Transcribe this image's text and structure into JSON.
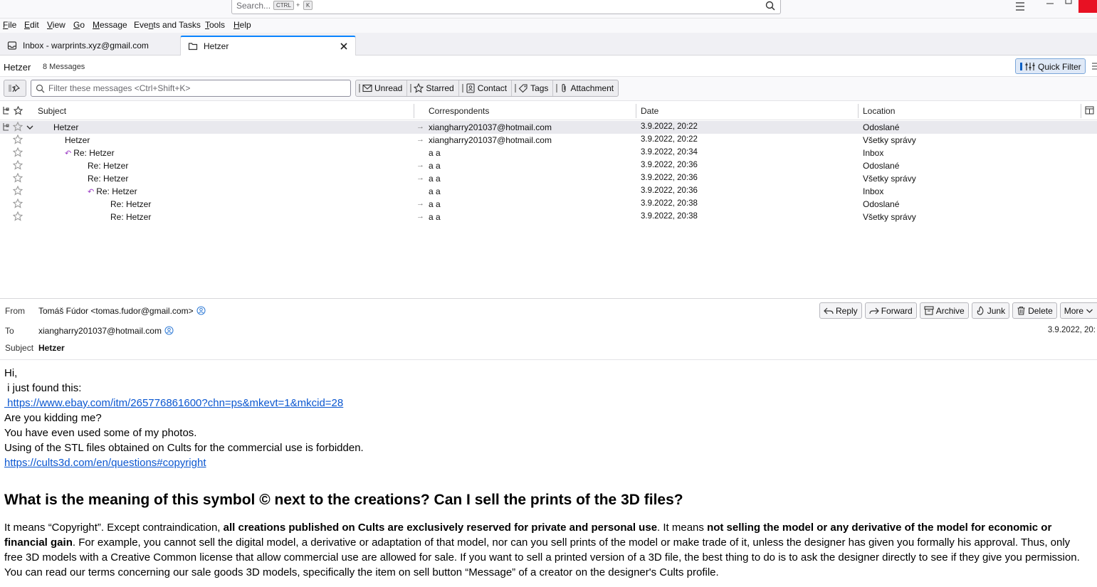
{
  "titlebar": {
    "search_placeholder": "Search...",
    "kbd1": "CTRL",
    "kbd_plus": "+",
    "kbd2": "K"
  },
  "menu": [
    {
      "u": "F",
      "rest": "ile"
    },
    {
      "u": "E",
      "rest": "dit"
    },
    {
      "u": "V",
      "rest": "iew"
    },
    {
      "u": "G",
      "rest": "o"
    },
    {
      "u": "M",
      "rest": "essage"
    },
    {
      "pre": "Eve",
      "u": "n",
      "rest": "ts and Tasks"
    },
    {
      "u": "T",
      "rest": "ools"
    },
    {
      "u": "H",
      "rest": "elp"
    }
  ],
  "tabs": {
    "inbox": "Inbox - warprints.xyz@gmail.com",
    "hetzer": "Hetzer"
  },
  "folder": {
    "name": "Hetzer",
    "count": "8 Messages",
    "quick_filter": "Quick Filter"
  },
  "filterbar": {
    "placeholder": "Filter these messages <Ctrl+Shift+K>",
    "buttons": [
      "Unread",
      "Starred",
      "Contact",
      "Tags",
      "Attachment"
    ]
  },
  "columns": {
    "subject": "Subject",
    "correspondents": "Correspondents",
    "date": "Date",
    "location": "Location"
  },
  "threads": [
    {
      "subject": "Hetzer",
      "arrow": "→",
      "corr": "xiangharry201037@hotmail.com",
      "date": "3.9.2022, 20:22",
      "loc": "Odoslané"
    },
    {
      "subject": "Hetzer",
      "arrow": "→",
      "corr": "xiangharry201037@hotmail.com",
      "date": "3.9.2022, 20:22",
      "loc": "Všetky správy"
    },
    {
      "subject": "Re: Hetzer",
      "arrow": "",
      "corr": "a a",
      "date": "3.9.2022, 20:34",
      "loc": "Inbox"
    },
    {
      "subject": "Re: Hetzer",
      "arrow": "→",
      "corr": "a a",
      "date": "3.9.2022, 20:36",
      "loc": "Odoslané"
    },
    {
      "subject": "Re: Hetzer",
      "arrow": "→",
      "corr": "a a",
      "date": "3.9.2022, 20:36",
      "loc": "Všetky správy"
    },
    {
      "subject": "Re: Hetzer",
      "arrow": "",
      "corr": "a a",
      "date": "3.9.2022, 20:36",
      "loc": "Inbox"
    },
    {
      "subject": "Re: Hetzer",
      "arrow": "→",
      "corr": "a a",
      "date": "3.9.2022, 20:38",
      "loc": "Odoslané"
    },
    {
      "subject": "Re: Hetzer",
      "arrow": "→",
      "corr": "a a",
      "date": "3.9.2022, 20:38",
      "loc": "Všetky správy"
    }
  ],
  "header": {
    "from_label": "From",
    "from": "Tomáš Fúdor <tomas.fudor@gmail.com>",
    "to_label": "To",
    "to": "xiangharry201037@hotmail.com",
    "subject_label": "Subject",
    "subject": "Hetzer",
    "date": "3.9.2022, 20:",
    "actions": [
      "Reply",
      "Forward",
      "Archive",
      "Junk",
      "Delete",
      "More"
    ]
  },
  "body": {
    "l1": "Hi,",
    "l2": " i just found this:",
    "link1": " https://www.ebay.com/itm/265776861600?chn=ps&mkevt=1&mkcid=28",
    "l3": "Are you kidding me?",
    "l4": "You have even used some of my photos.",
    "l5": "Using of the STL files obtained on Cults for the commercial use is forbidden.",
    "link2": "https://cults3d.com/en/questions#copyright",
    "heading": "What is the meaning of this symbol © next to the creations? Can I sell the prints of the 3D files?",
    "p1": "It means “Copyright”. Except contraindication, ",
    "p1b": "all creations published on Cults are exclusively reserved for private and personal use",
    "p2": ". It means ",
    "p2b": "not selling the model or any derivative of the model for economic or financial gain",
    "p3": ". For example, you cannot sell the digital model, a derivative or adaptation of that model, nor can you sell prints of the model or make trade of it, unless the designer has given you formally his approval. Thus, only free 3D models with a Creative Common license that allow commercial use are allowed for sale. If you want to sell a printed version of a 3D file, the best thing to do is to ask the designer directly to see if they give you permission. You can read our terms concerning our sale goods 3D models, specifically the item on sell button “Message” of a creator on the designer's Cults profile."
  }
}
